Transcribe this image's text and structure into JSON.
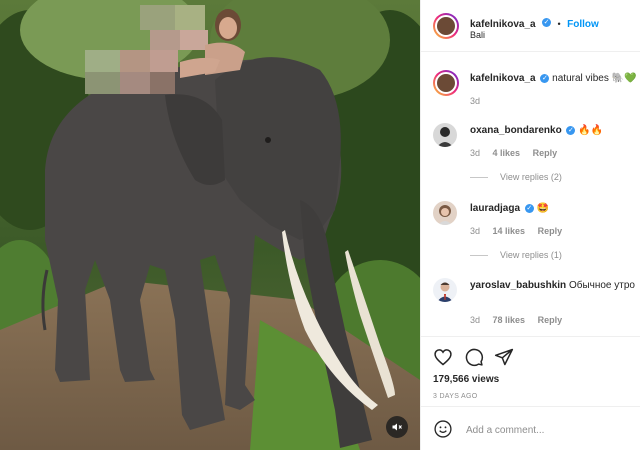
{
  "post": {
    "author": "kafelnikova_a",
    "location": "Bali",
    "follow_label": "Follow",
    "separator": "•",
    "caption_text": "natural vibes 🐘💚",
    "caption_age": "3d",
    "views": "179,566 views",
    "date": "3 DAYS AGO"
  },
  "comments": [
    {
      "username": "oxana_bondarenko",
      "verified": true,
      "text": "🔥🔥",
      "age": "3d",
      "likes": "4 likes",
      "reply_label": "Reply",
      "view_replies": "View replies (2)"
    },
    {
      "username": "lauradjaga",
      "verified": true,
      "text": "🤩",
      "age": "3d",
      "likes": "14 likes",
      "reply_label": "Reply",
      "view_replies": "View replies (1)"
    },
    {
      "username": "yaroslav_babushkin",
      "verified": false,
      "text": "Обычное утро",
      "age": "3d",
      "likes": "78 likes",
      "reply_label": "Reply"
    }
  ],
  "add_comment": {
    "placeholder": "Add a comment..."
  },
  "icons": {
    "verified": "verified-badge-icon",
    "like": "heart-icon",
    "comment": "comment-bubble-icon",
    "share": "paper-plane-icon",
    "emoji": "emoji-smile-icon",
    "mute": "speaker-muted-icon"
  },
  "colors": {
    "link": "#0095f6",
    "verified": "#3897f0",
    "muted_text": "#8e8e8e",
    "border": "#efefef"
  }
}
